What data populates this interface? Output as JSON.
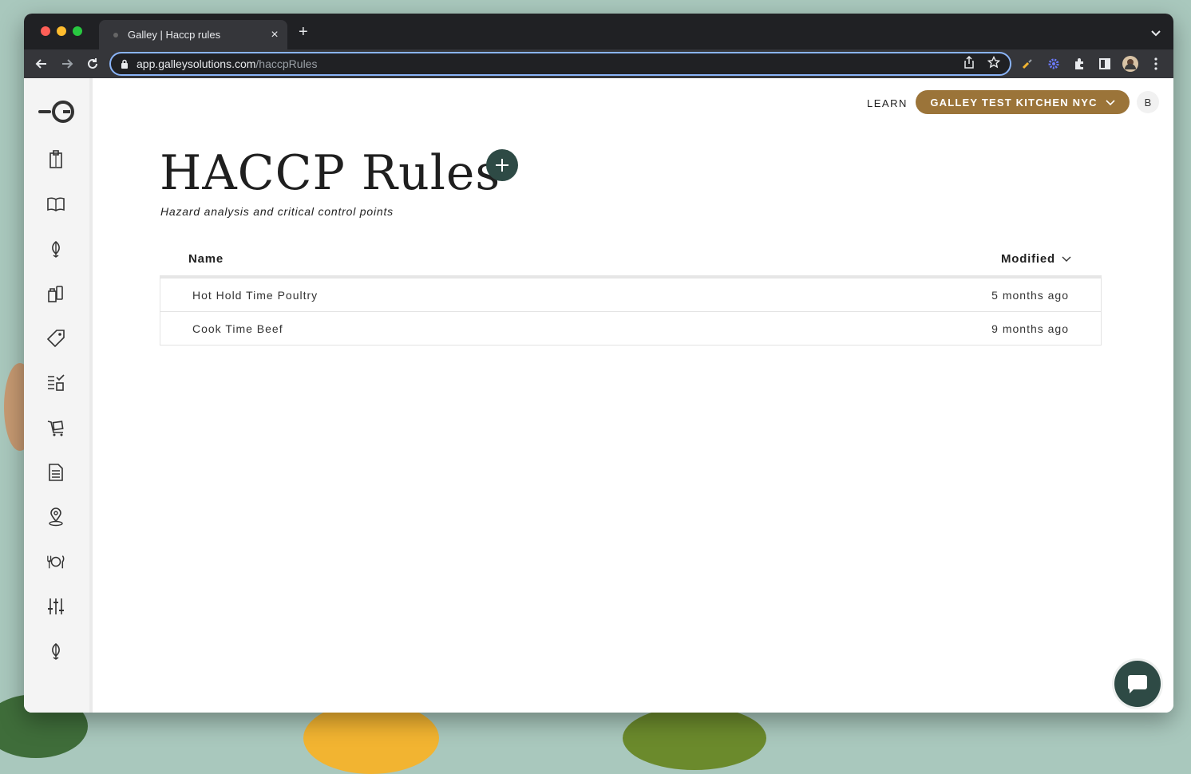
{
  "browser": {
    "tab_title": "Galley | Haccp rules",
    "close_glyph": "×",
    "new_tab_glyph": "+",
    "url_host": "app.galleysolutions.com",
    "url_path": "/haccpRules",
    "traffic_lights": [
      "#ff5f57",
      "#febc2e",
      "#28c840"
    ]
  },
  "header": {
    "learn_label": "LEARN",
    "location_label": "GALLEY TEST KITCHEN NYC",
    "avatar_initial": "B",
    "location_color": "#9b7439"
  },
  "sidebar": {
    "items": [
      {
        "icon": "clipboard-icon"
      },
      {
        "icon": "book-icon"
      },
      {
        "icon": "ingredient-icon"
      },
      {
        "icon": "containers-icon"
      },
      {
        "icon": "tag-icon"
      },
      {
        "icon": "checklist-icon"
      },
      {
        "icon": "cart-icon"
      },
      {
        "icon": "document-icon"
      },
      {
        "icon": "location-icon"
      },
      {
        "icon": "plate-utensils-icon"
      },
      {
        "icon": "sliders-icon"
      },
      {
        "icon": "ingredient-icon"
      }
    ]
  },
  "main": {
    "title": "HACCP Rules",
    "subtitle": "Hazard analysis and critical control points",
    "table": {
      "columns": [
        "Name",
        "Modified"
      ],
      "rows": [
        {
          "name": "Hot Hold Time Poultry",
          "modified": "5 months ago"
        },
        {
          "name": "Cook Time Beef",
          "modified": "9 months ago"
        }
      ]
    },
    "accent_color": "#2e4a45"
  }
}
